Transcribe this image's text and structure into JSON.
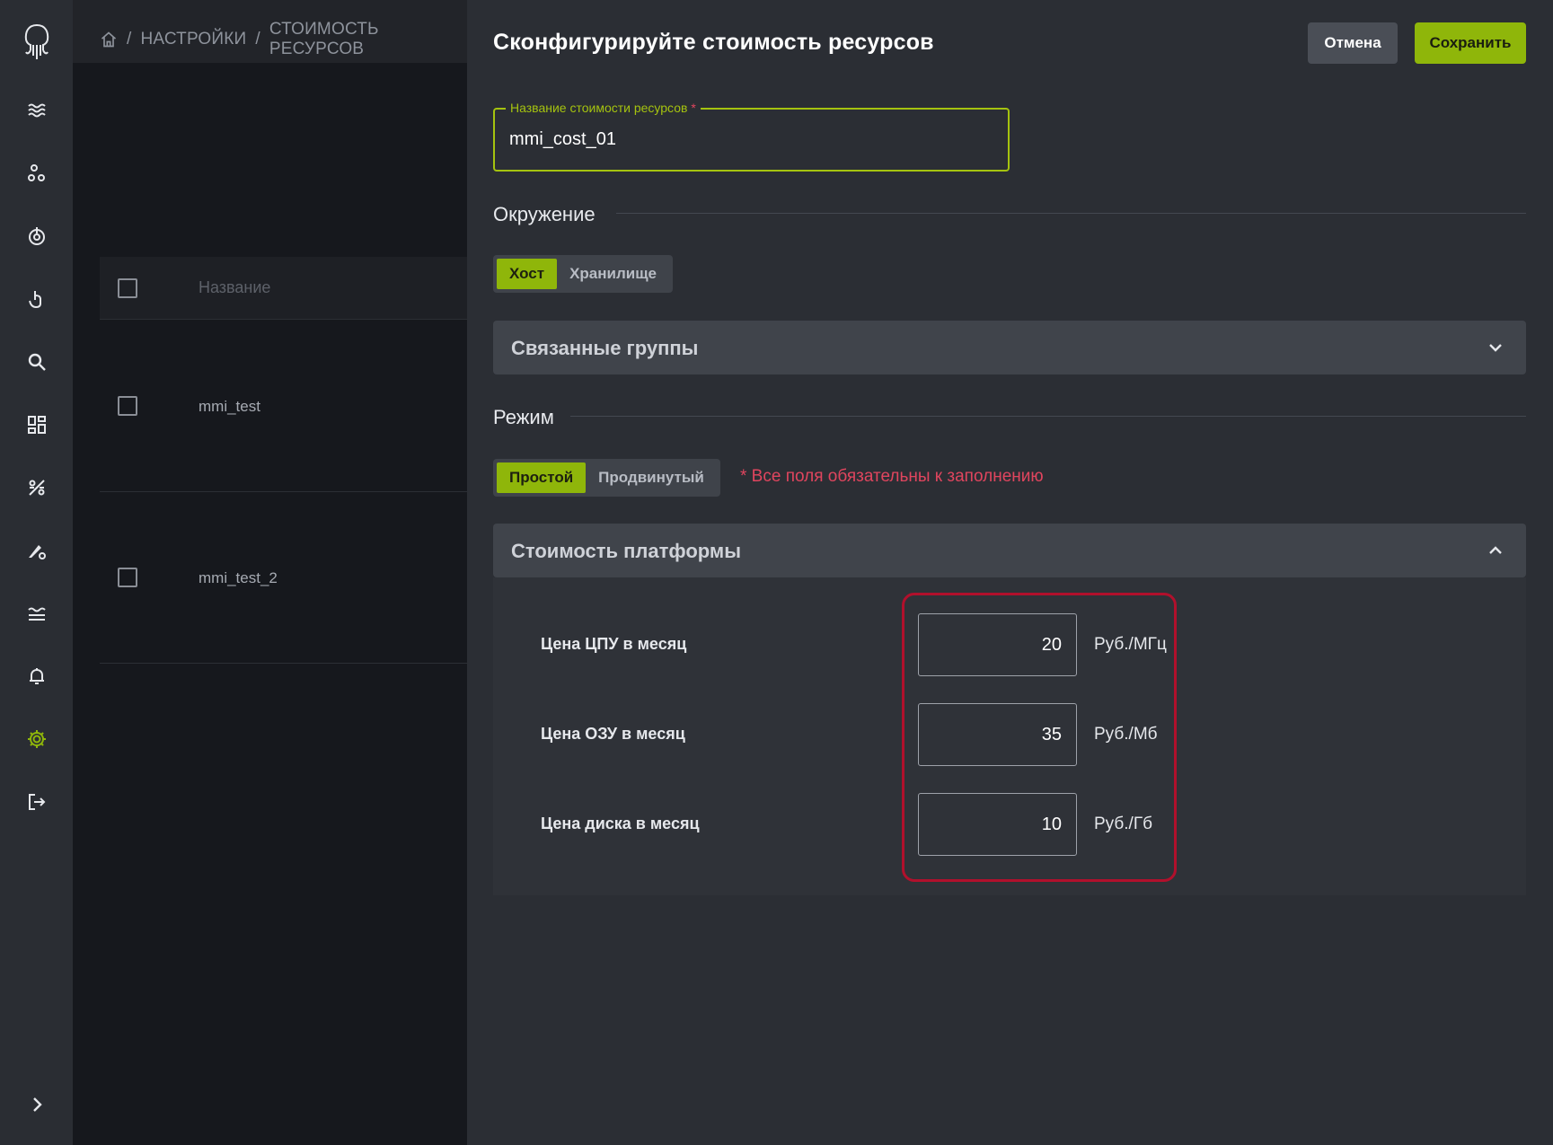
{
  "breadcrumb": {
    "home_icon": "home-icon",
    "items": [
      "НАСТРОЙКИ",
      "СТОИМОСТЬ РЕСУРСОВ"
    ],
    "separator": "/"
  },
  "sidebar": {
    "icons": [
      "logo-icon",
      "layers-icon",
      "cluster-icon",
      "power-icon",
      "touch-icon",
      "search-icon",
      "dashboard-icon",
      "percent-icon",
      "settings-brush-icon",
      "waves-icon",
      "bell-icon",
      "gear-icon",
      "logout-icon",
      "chevron-right-icon"
    ],
    "active": "gear-icon",
    "accent": "#8fb60a"
  },
  "list": {
    "header_label": "Название",
    "rows": [
      "mmi_test",
      "mmi_test_2"
    ]
  },
  "panel": {
    "title": "Сконфигурируйте стоимость ресурсов",
    "cancel_label": "Отмена",
    "save_label": "Сохранить",
    "name_field": {
      "label": "Название стоимости ресурсов",
      "required_mark": "*",
      "value": "mmi_cost_01"
    },
    "environment": {
      "heading": "Окружение",
      "options": [
        "Хост",
        "Хранилище"
      ],
      "selected": "Хост"
    },
    "linked_groups": {
      "title": "Связанные группы",
      "expanded": false
    },
    "mode": {
      "heading": "Режим",
      "options": [
        "Простой",
        "Продвинутый"
      ],
      "selected": "Простой",
      "required_note": "* Все поля обязательны к заполнению"
    },
    "platform_cost": {
      "title": "Стоимость платформы",
      "expanded": true,
      "items": [
        {
          "label": "Цена ЦПУ в месяц",
          "value": "20",
          "unit": "Руб./МГц"
        },
        {
          "label": "Цена ОЗУ в месяц",
          "value": "35",
          "unit": "Руб./Мб"
        },
        {
          "label": "Цена диска в месяц",
          "value": "10",
          "unit": "Руб./Гб"
        }
      ]
    }
  },
  "colors": {
    "accent": "#8fb60a",
    "required": "#e0455e",
    "highlight": "#b1102c"
  }
}
